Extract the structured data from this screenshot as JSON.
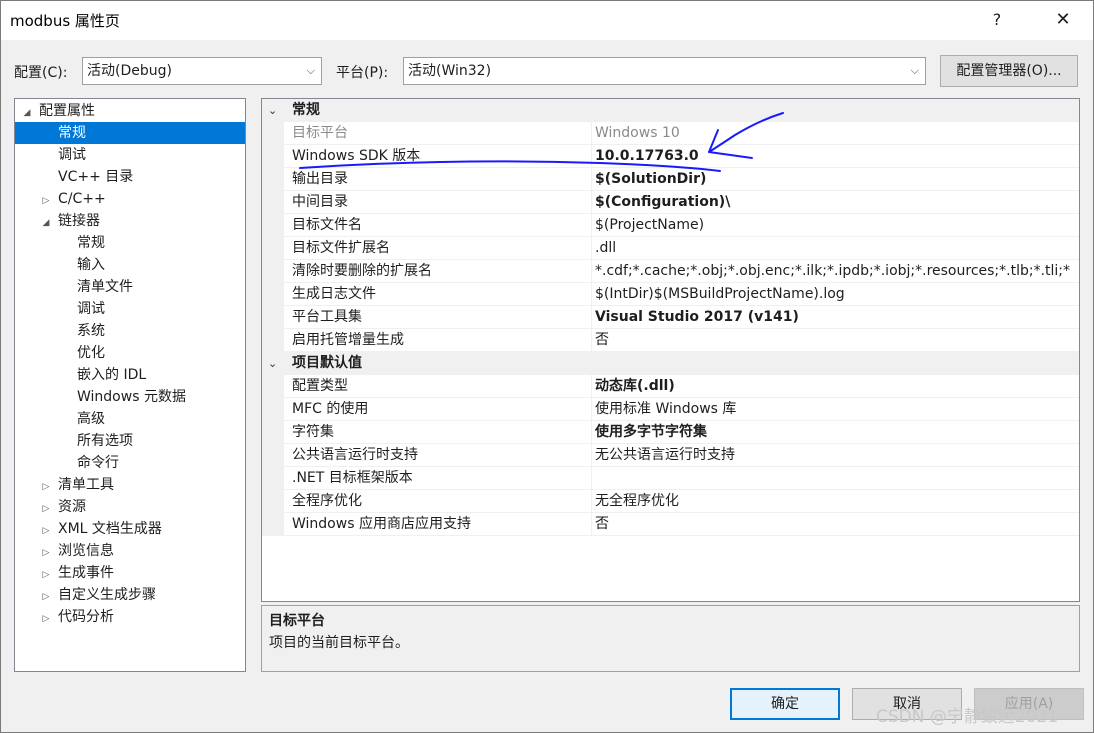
{
  "window": {
    "title": "modbus 属性页",
    "help": "?",
    "close": "✕"
  },
  "toolbar": {
    "config_label": "配置(C):",
    "config_value": "活动(Debug)",
    "platform_label": "平台(P):",
    "platform_value": "活动(Win32)",
    "config_manager": "配置管理器(O)..."
  },
  "tree": {
    "items": [
      {
        "label": "配置属性",
        "toggle": "◢"
      },
      {
        "label": "常规",
        "toggle": ""
      },
      {
        "label": "调试",
        "toggle": ""
      },
      {
        "label": "VC++ 目录",
        "toggle": ""
      },
      {
        "label": "C/C++",
        "toggle": "▷"
      },
      {
        "label": "链接器",
        "toggle": "◢"
      },
      {
        "label": "常规",
        "toggle": ""
      },
      {
        "label": "输入",
        "toggle": ""
      },
      {
        "label": "清单文件",
        "toggle": ""
      },
      {
        "label": "调试",
        "toggle": ""
      },
      {
        "label": "系统",
        "toggle": ""
      },
      {
        "label": "优化",
        "toggle": ""
      },
      {
        "label": "嵌入的 IDL",
        "toggle": ""
      },
      {
        "label": "Windows 元数据",
        "toggle": ""
      },
      {
        "label": "高级",
        "toggle": ""
      },
      {
        "label": "所有选项",
        "toggle": ""
      },
      {
        "label": "命令行",
        "toggle": ""
      },
      {
        "label": "清单工具",
        "toggle": "▷"
      },
      {
        "label": "资源",
        "toggle": "▷"
      },
      {
        "label": "XML 文档生成器",
        "toggle": "▷"
      },
      {
        "label": "浏览信息",
        "toggle": "▷"
      },
      {
        "label": "生成事件",
        "toggle": "▷"
      },
      {
        "label": "自定义生成步骤",
        "toggle": "▷"
      },
      {
        "label": "代码分析",
        "toggle": "▷"
      }
    ]
  },
  "grid": {
    "cat_general": "常规",
    "cat_defaults": "项目默认值",
    "general_rows": [
      {
        "name": "目标平台",
        "value": "Windows 10"
      },
      {
        "name": "Windows SDK 版本",
        "value": "10.0.17763.0"
      },
      {
        "name": "输出目录",
        "value": "$(SolutionDir)"
      },
      {
        "name": "中间目录",
        "value": "$(Configuration)\\"
      },
      {
        "name": "目标文件名",
        "value": "$(ProjectName)"
      },
      {
        "name": "目标文件扩展名",
        "value": ".dll"
      },
      {
        "name": "清除时要删除的扩展名",
        "value": "*.cdf;*.cache;*.obj;*.obj.enc;*.ilk;*.ipdb;*.iobj;*.resources;*.tlb;*.tli;*"
      },
      {
        "name": "生成日志文件",
        "value": "$(IntDir)$(MSBuildProjectName).log"
      },
      {
        "name": "平台工具集",
        "value": "Visual Studio 2017 (v141)"
      },
      {
        "name": "启用托管增量生成",
        "value": "否"
      }
    ],
    "default_rows": [
      {
        "name": "配置类型",
        "value": "动态库(.dll)"
      },
      {
        "name": "MFC 的使用",
        "value": "使用标准 Windows 库"
      },
      {
        "name": "字符集",
        "value": "使用多字节字符集"
      },
      {
        "name": "公共语言运行时支持",
        "value": "无公共语言运行时支持"
      },
      {
        "name": ".NET 目标框架版本",
        "value": ""
      },
      {
        "name": "全程序优化",
        "value": "无全程序优化"
      },
      {
        "name": "Windows 应用商店应用支持",
        "value": "否"
      }
    ]
  },
  "description": {
    "title": "目标平台",
    "text": "项目的当前目标平台。"
  },
  "buttons": {
    "ok": "确定",
    "cancel": "取消",
    "apply": "应用(A)"
  },
  "watermark": "CSDN @宁静致远2021",
  "colors": {
    "selection": "#0078d7",
    "annotation": "#1a1aff"
  }
}
